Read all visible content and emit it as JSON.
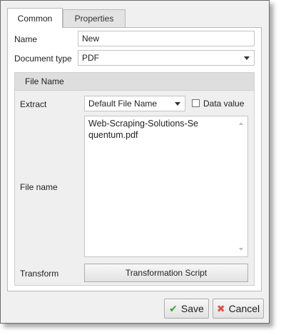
{
  "tabs": [
    {
      "label": "Common",
      "active": true
    },
    {
      "label": "Properties",
      "active": false
    }
  ],
  "form": {
    "name_label": "Name",
    "name_value": "New",
    "doctype_label": "Document type",
    "doctype_value": "PDF"
  },
  "file_name_group": {
    "header": "File Name",
    "extract_label": "Extract",
    "extract_value": "Default File Name",
    "data_value_label": "Data value",
    "data_value_checked": false,
    "file_name_label": "File name",
    "file_name_value": "Web-Scraping-Solutions-Sequentum.pdf",
    "transform_label": "Transform",
    "transform_button": "Transformation Script"
  },
  "footer": {
    "save_label": "Save",
    "save_icon": "checkmark-icon",
    "save_icon_color": "#3c9d3c",
    "cancel_label": "Cancel",
    "cancel_icon": "x-icon",
    "cancel_icon_color": "#d9534f"
  }
}
